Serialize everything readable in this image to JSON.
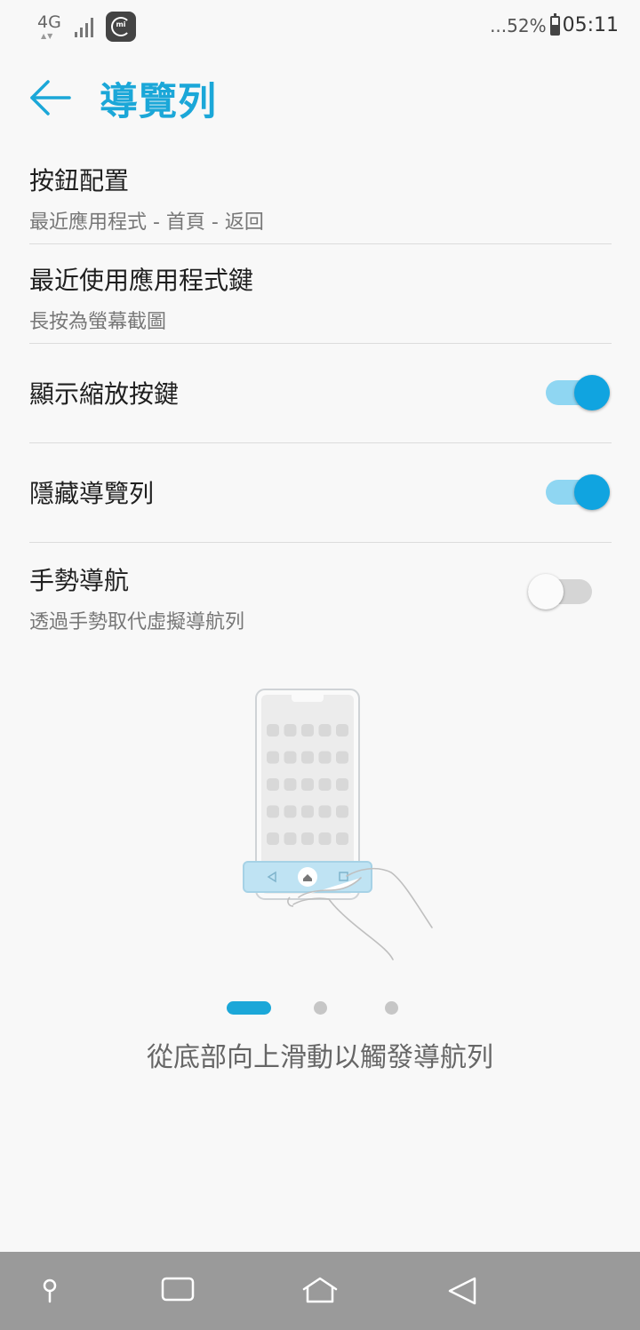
{
  "status_bar": {
    "network": "4G",
    "battery_text": "...52%",
    "battery_level": 0.52,
    "time": "05:11",
    "mi_label": "mi"
  },
  "header": {
    "title": "導覽列"
  },
  "settings": {
    "button_layout": {
      "title": "按鈕配置",
      "subtitle": "最近應用程式 - 首頁 - 返回"
    },
    "recent_key": {
      "title": "最近使用應用程式鍵",
      "subtitle": "長按為螢幕截圖"
    },
    "show_zoom": {
      "title": "顯示縮放按鍵",
      "enabled": true
    },
    "hide_nav": {
      "title": "隱藏導覽列",
      "enabled": true
    },
    "gesture_nav": {
      "title": "手勢導航",
      "subtitle": "透過手勢取代虛擬導航列",
      "enabled": false
    }
  },
  "tutorial": {
    "caption": "從底部向上滑動以觸發導航列",
    "page_count": 3,
    "current_page": 1
  },
  "colors": {
    "accent": "#1ba7d8",
    "toggle_on": "#10a4e0",
    "nav_bar": "#9a9a9a"
  },
  "nav_bar": {
    "icons": [
      "pin-icon",
      "recents-icon",
      "home-icon",
      "back-icon"
    ]
  }
}
